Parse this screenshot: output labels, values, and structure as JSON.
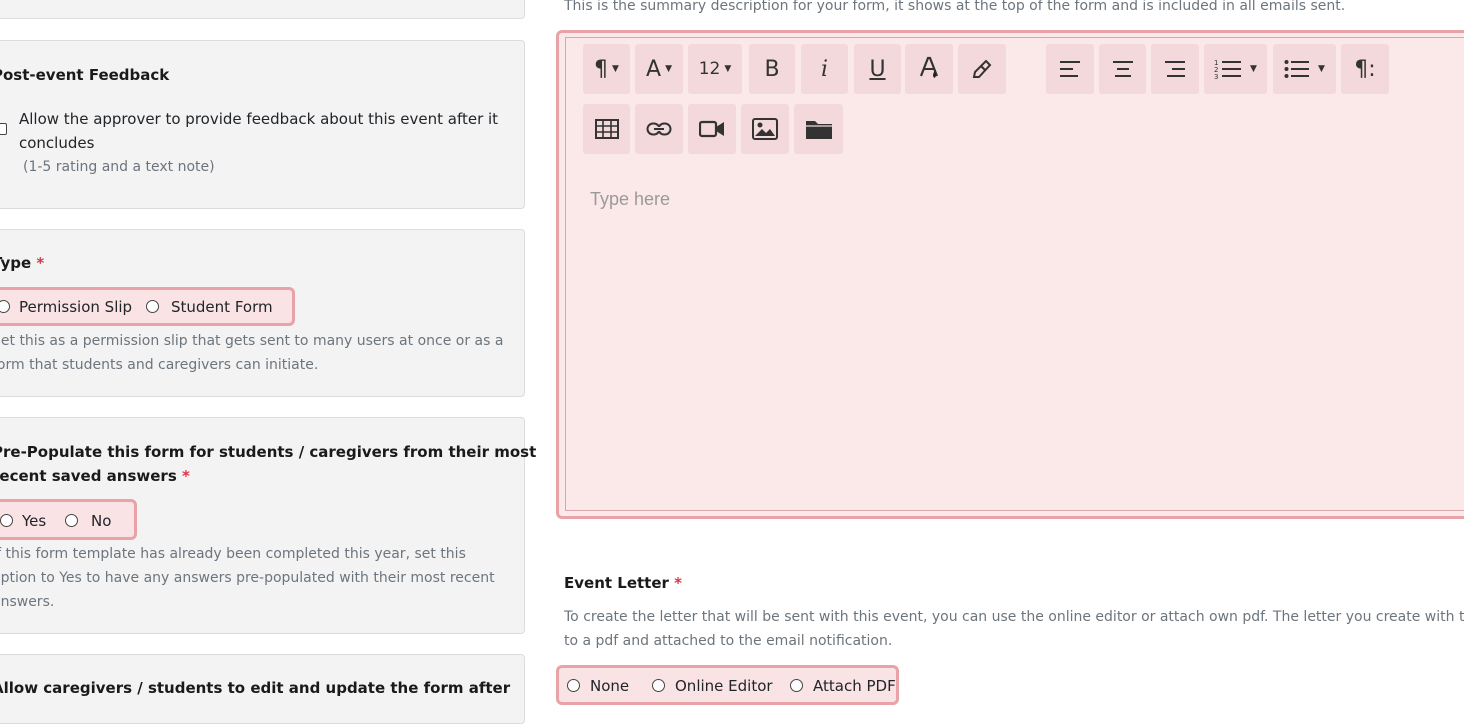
{
  "top_description": "This is the summary description for your form, it shows at the top of the form and is included in all emails sent.",
  "feedback": {
    "title": "Post-event Feedback",
    "checkbox_label_line1": "Allow the approver to provide feedback about this event after it",
    "checkbox_label_line2": "concludes",
    "note": "(1-5 rating and a text note)"
  },
  "type_section": {
    "title": "Type",
    "required": "*",
    "options": [
      "Permission Slip",
      "Student Form"
    ],
    "help_line1": "Set this as a permission slip that gets sent to many users at once or as a",
    "help_line2": "form that students and caregivers can initiate."
  },
  "prepopulate": {
    "title_line1": "Pre-Populate this form for students / caregivers from their most",
    "title_line2": "recent saved answers",
    "required": "*",
    "options": [
      "Yes",
      "No"
    ],
    "help_line1": "If this form template has already been completed this year, set this",
    "help_line2": "option to Yes to have any answers pre-populated with their most recent",
    "help_line3": "answers."
  },
  "allow_edit": {
    "title": "Allow caregivers / students to edit and update the form after"
  },
  "editor": {
    "font_size": "12",
    "placeholder": "Type here",
    "italic_label": "i",
    "bold_label": "B",
    "underline_label": "U",
    "paragraph_symbol": "¶",
    "font_symbol": "A"
  },
  "event_letter": {
    "title": "Event Letter",
    "required": "*",
    "help_line1": "To create the letter that will be sent with this event, you can use the online editor or attach own pdf. The letter you create with the",
    "help_line2": "to a pdf and attached to the email notification.",
    "options": [
      "None",
      "Online Editor",
      "Attach PDF"
    ]
  },
  "colors": {
    "required": "#dc3545",
    "invalid_border": "#e8a2a8",
    "invalid_bg": "#f9e3e5"
  }
}
